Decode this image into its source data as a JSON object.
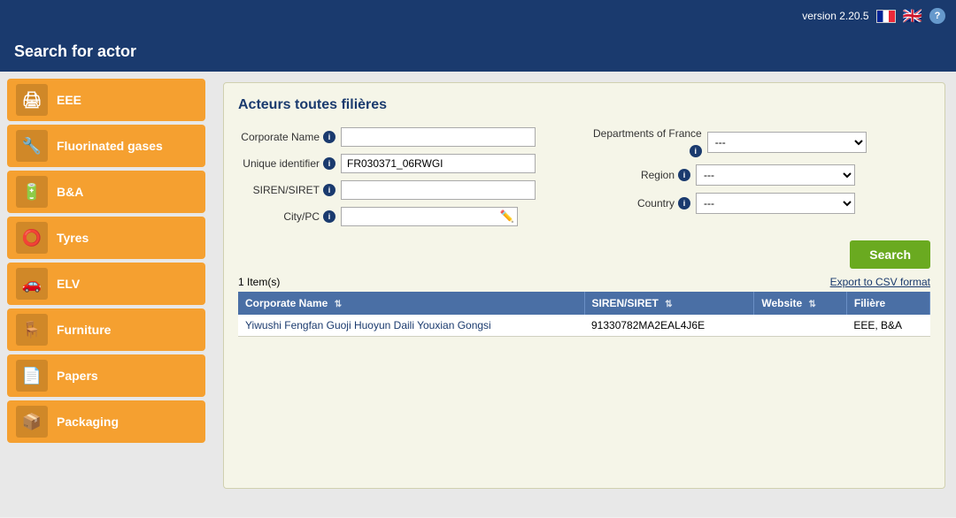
{
  "topbar": {
    "version": "version 2.20.5",
    "help_label": "?"
  },
  "header": {
    "title": "Search for actor"
  },
  "sidebar": {
    "items": [
      {
        "id": "eee",
        "label": "EEE",
        "icon": "🖨"
      },
      {
        "id": "fluorinated-gases",
        "label": "Fluorinated gases",
        "icon": "🔧"
      },
      {
        "id": "bna",
        "label": "B&A",
        "icon": "🔋"
      },
      {
        "id": "tyres",
        "label": "Tyres",
        "icon": "⭕"
      },
      {
        "id": "elv",
        "label": "ELV",
        "icon": "🚗"
      },
      {
        "id": "furniture",
        "label": "Furniture",
        "icon": "🪑"
      },
      {
        "id": "papers",
        "label": "Papers",
        "icon": "📄"
      },
      {
        "id": "packaging",
        "label": "Packaging",
        "icon": "📦"
      }
    ]
  },
  "panel": {
    "title": "Acteurs toutes filières",
    "form": {
      "corporate_name_label": "Corporate Name",
      "unique_identifier_label": "Unique identifier",
      "siren_siret_label": "SIREN/SIRET",
      "city_pc_label": "City/PC",
      "departments_france_label": "Departments of France",
      "region_label": "Region",
      "country_label": "Country",
      "corporate_name_value": "",
      "unique_identifier_value": "FR030371_06RWGI",
      "siren_siret_value": "",
      "city_pc_value": "",
      "departments_default": "---",
      "region_default": "---",
      "country_default": "---"
    },
    "search_button": "Search",
    "results_count": "1 Item(s)",
    "export_link": "Export to CSV format",
    "table": {
      "headers": [
        {
          "label": "Corporate Name",
          "sortable": true
        },
        {
          "label": "SIREN/SIRET",
          "sortable": true
        },
        {
          "label": "Website",
          "sortable": true
        },
        {
          "label": "Filière",
          "sortable": false
        }
      ],
      "rows": [
        {
          "corporate_name": "Yiwushi Fengfan Guoji Huoyun Daili Youxian Gongsi",
          "siren_siret": "91330782MA2EAL4J6E",
          "website": "",
          "filiere": "EEE, B&A"
        }
      ]
    }
  }
}
